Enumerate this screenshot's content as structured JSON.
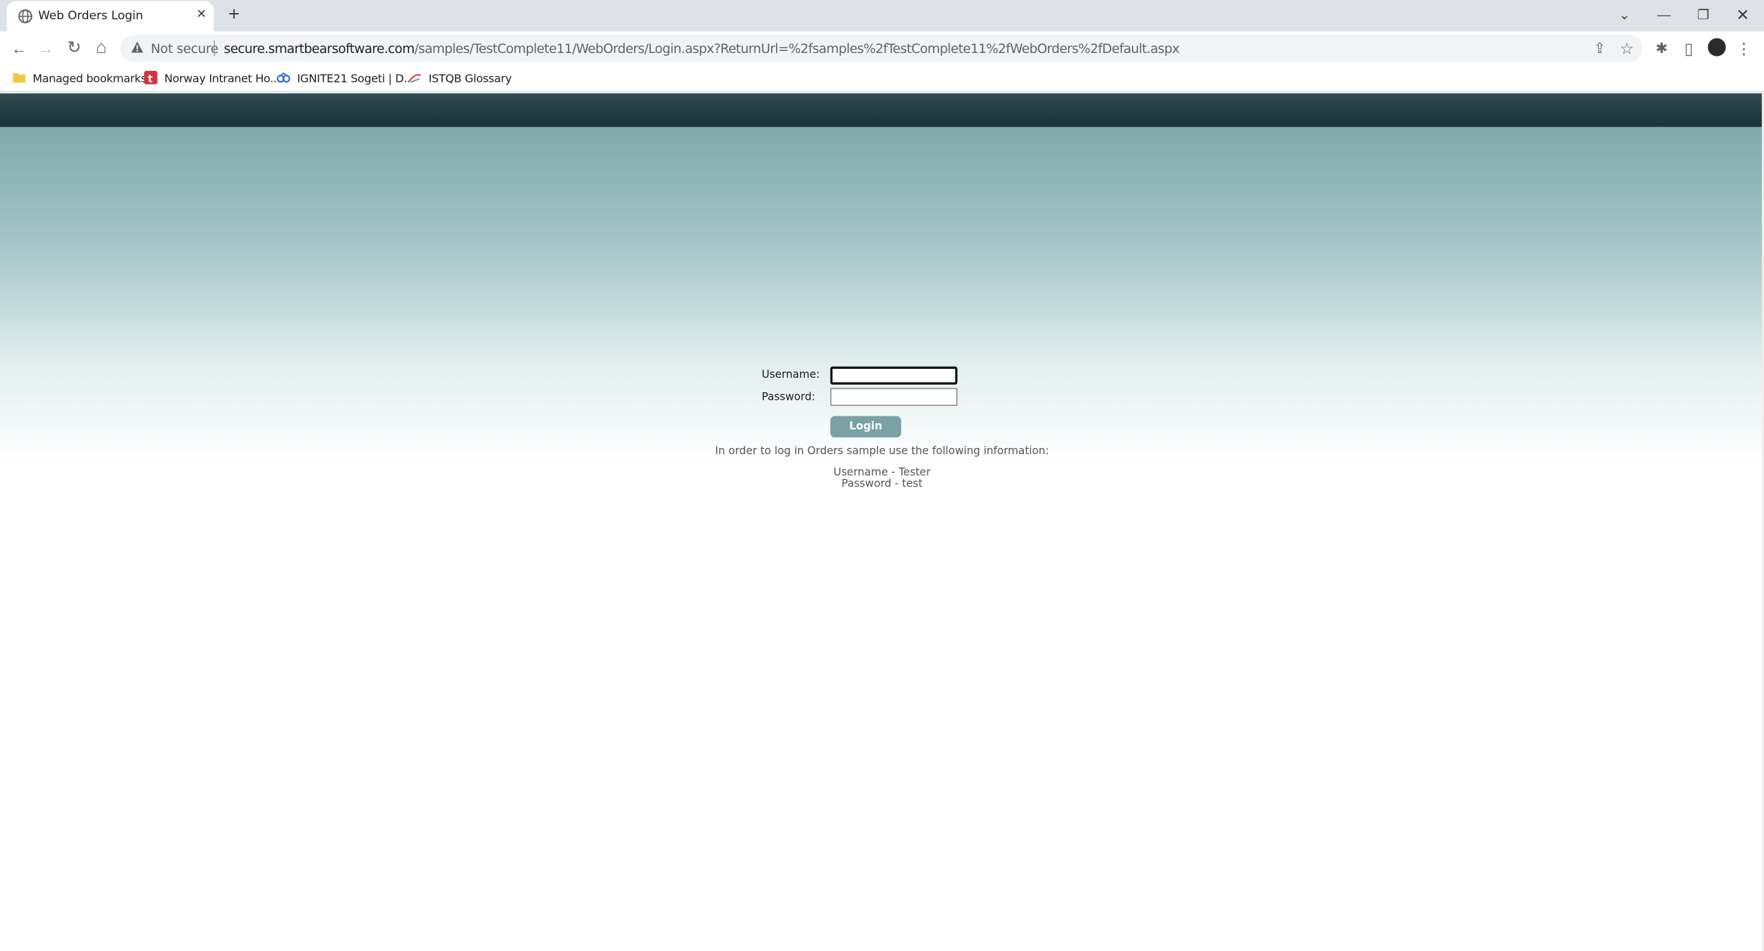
{
  "browser": {
    "tab": {
      "title": "Web Orders Login",
      "close_glyph": "✕"
    },
    "new_tab_glyph": "+",
    "window_controls": {
      "tab_search": "⌄",
      "minimize": "—",
      "restore": "❐",
      "close": "✕"
    },
    "address_bar": {
      "security_label": "Not secure",
      "url_host": "secure.smartbearsoftware.com",
      "url_path": "/samples/TestComplete11/WebOrders/Login.aspx?ReturnUrl=%2fsamples%2fTestComplete11%2fWebOrders%2fDefault.aspx"
    },
    "nav_glyphs": {
      "back": "←",
      "forward": "→",
      "reload": "↻",
      "home": "⌂"
    },
    "toolbar_glyphs": {
      "share": "⇪",
      "bookmark_star": "☆",
      "extensions": "✱",
      "side_panel": "▯",
      "menu": "⋮"
    },
    "bookmarks": [
      {
        "label": "Managed bookmarks",
        "icon": "folder-icon"
      },
      {
        "label": "Norway Intranet Ho...",
        "icon": "intranet-icon"
      },
      {
        "label": "IGNITE21 Sogeti | D...",
        "icon": "ignite-icon"
      },
      {
        "label": "ISTQB Glossary",
        "icon": "istqb-icon"
      }
    ]
  },
  "login": {
    "username_label": "Username:",
    "password_label": "Password:",
    "username_value": "",
    "password_value": "",
    "button_label": "Login",
    "info_text": "In order to log in Orders sample use the following information:",
    "credentials_username": "Username - Tester",
    "credentials_password": "Password - test"
  },
  "colors": {
    "header_bar": "#1d3236",
    "gradient_top": "#7fa9ab",
    "button": "#7aa1a4"
  }
}
